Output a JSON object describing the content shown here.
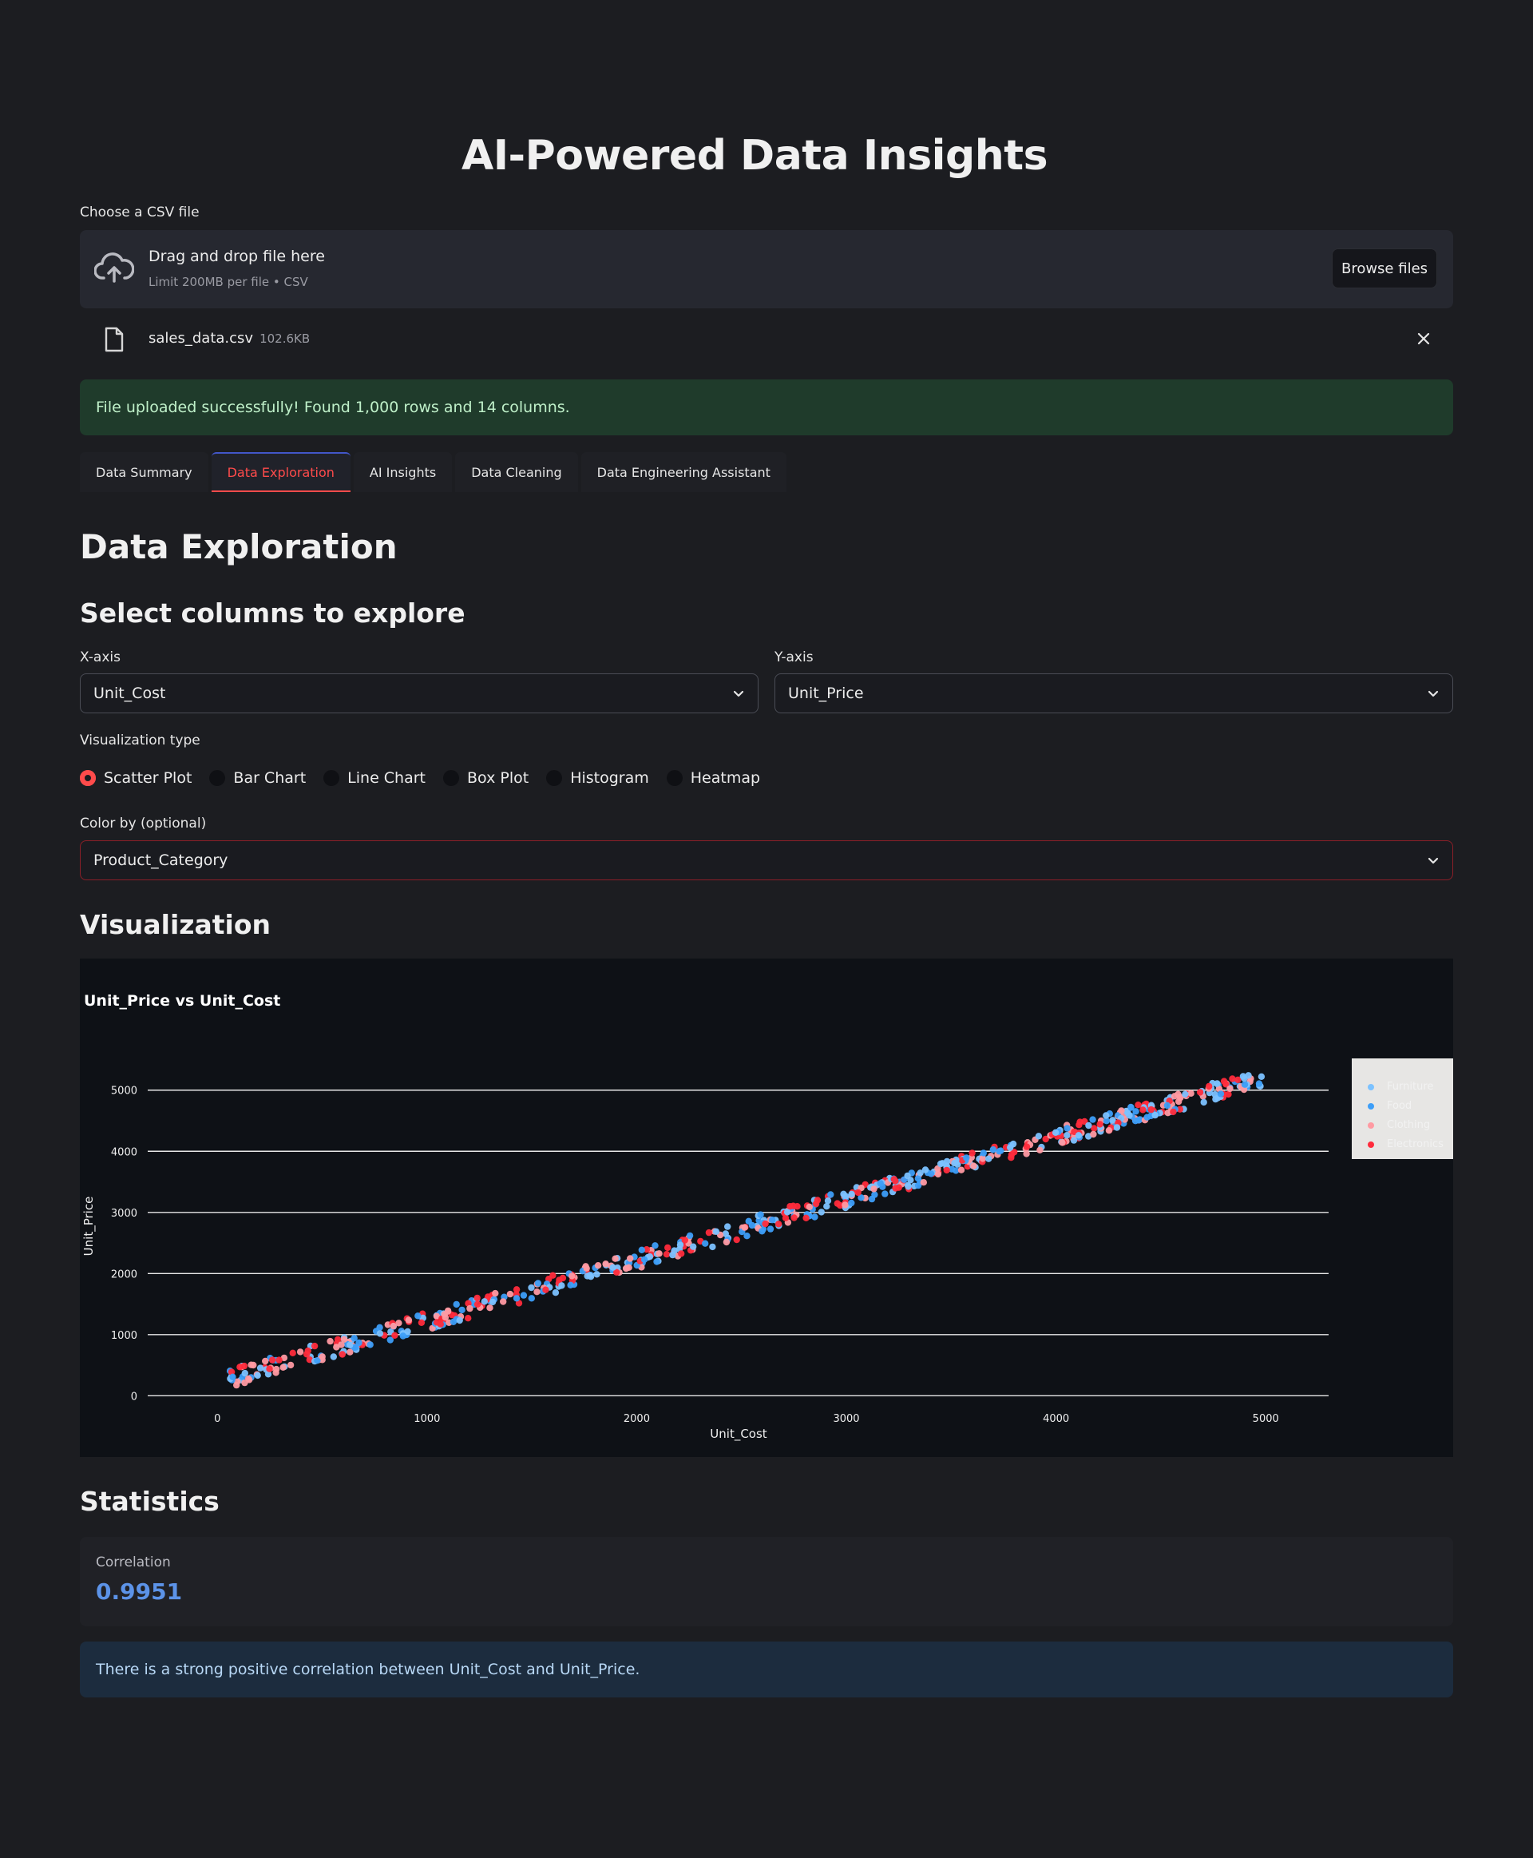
{
  "page": {
    "title": "AI-Powered Data Insights"
  },
  "uploader": {
    "label": "Choose a CSV file",
    "main_text": "Drag and drop file here",
    "sub_text": "Limit 200MB per file • CSV",
    "browse_label": "Browse files",
    "file_name": "sales_data.csv",
    "file_size": "102.6KB",
    "close_icon": "close-icon"
  },
  "success_message": "File uploaded successfully! Found 1,000 rows and 14 columns.",
  "tabs": [
    {
      "label": "Data Summary",
      "active": false
    },
    {
      "label": "Data Exploration",
      "active": true
    },
    {
      "label": "AI Insights",
      "active": false
    },
    {
      "label": "Data Cleaning",
      "active": false
    },
    {
      "label": "Data Engineering Assistant",
      "active": false
    }
  ],
  "exploration": {
    "heading": "Data Exploration",
    "subheading": "Select columns to explore",
    "x_axis": {
      "label": "X-axis",
      "value": "Unit_Cost"
    },
    "y_axis": {
      "label": "Y-axis",
      "value": "Unit_Price"
    },
    "viz_type": {
      "label": "Visualization type",
      "options": [
        "Scatter Plot",
        "Bar Chart",
        "Line Chart",
        "Box Plot",
        "Histogram",
        "Heatmap"
      ],
      "selected": "Scatter Plot"
    },
    "color_by": {
      "label": "Color by (optional)",
      "value": "Product_Category"
    },
    "viz_heading": "Visualization"
  },
  "colors": {
    "accent": "#ff4b4b",
    "series": [
      "#7cc2ff",
      "#3d9ef8",
      "#ff9aa2",
      "#ff2b3b"
    ]
  },
  "chart_data": {
    "type": "scatter",
    "title": "Unit_Price vs Unit_Cost",
    "xlabel": "Unit_Cost",
    "ylabel": "Unit_Price",
    "xlim": [
      -100,
      5300
    ],
    "ylim": [
      -100,
      5650
    ],
    "xticks": [
      0,
      1000,
      2000,
      3000,
      4000,
      5000
    ],
    "yticks": [
      0,
      1000,
      2000,
      3000,
      4000,
      5000
    ],
    "grid": "horizontal",
    "legend_placement": "right",
    "series": [
      {
        "name": "Furniture",
        "color": "#7cc2ff"
      },
      {
        "name": "Food",
        "color": "#3d9ef8"
      },
      {
        "name": "Clothing",
        "color": "#ff9aa2"
      },
      {
        "name": "Electronics",
        "color": "#ff2b3b"
      }
    ],
    "trend": {
      "x_start": 60,
      "y_start": 280,
      "x_end": 5000,
      "y_end": 5230
    },
    "point_count": 1000
  },
  "statistics": {
    "heading": "Statistics",
    "metric_label": "Correlation",
    "metric_value": "0.9951",
    "info": "There is a strong positive correlation between Unit_Cost and Unit_Price."
  }
}
